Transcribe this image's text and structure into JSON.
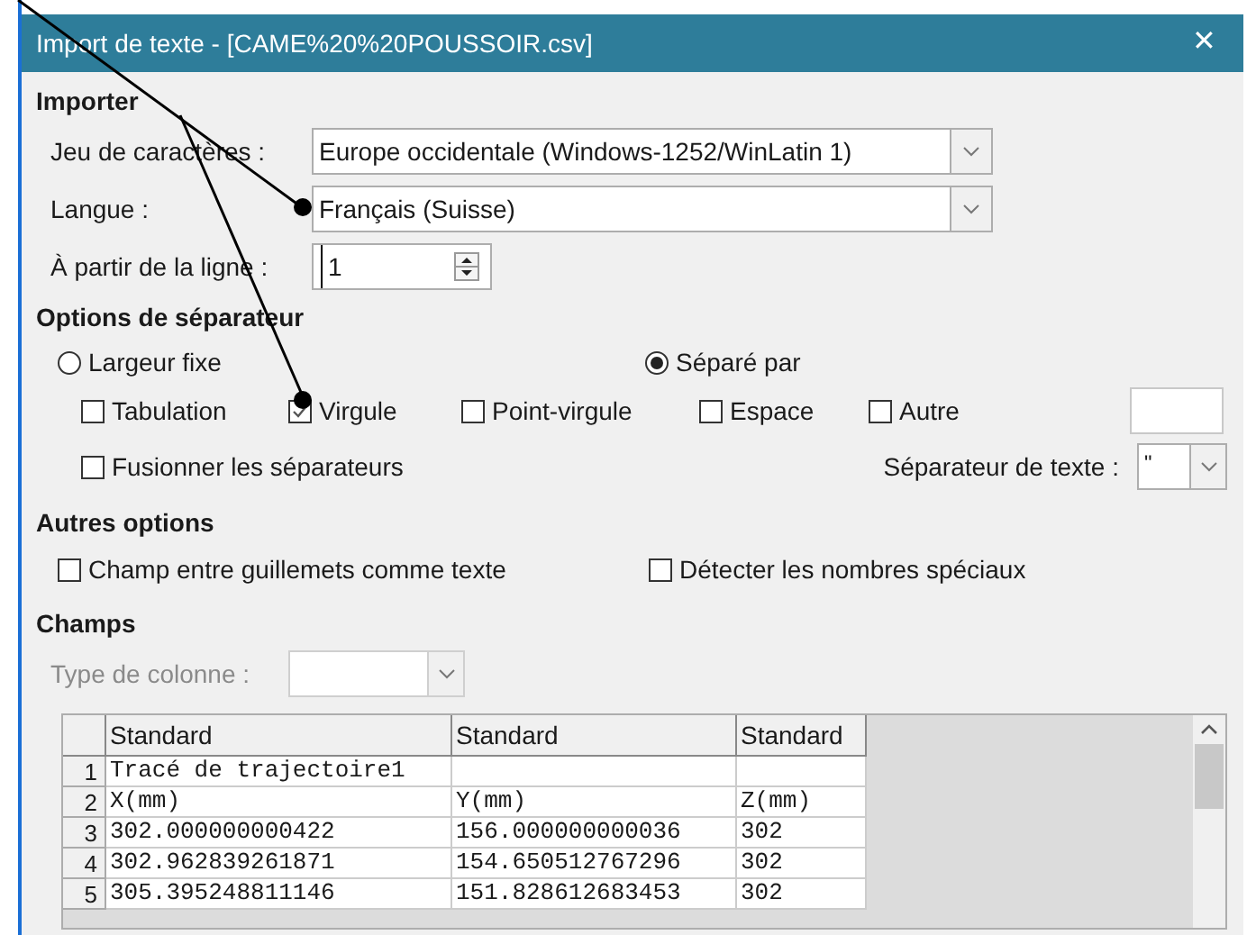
{
  "window": {
    "title": "Import de texte - [CAME%20%20POUSSOIR.csv]",
    "close": "✕"
  },
  "import": {
    "heading": "Importer",
    "fields": [
      {
        "kind": "combo",
        "label": "Jeu de caractères :",
        "value": "Europe occidentale (Windows-1252/WinLatin 1)"
      },
      {
        "kind": "combo",
        "label": "Langue :",
        "value": "Français (Suisse)"
      },
      {
        "kind": "spin",
        "label": "À partir de la ligne :",
        "value": "1"
      }
    ]
  },
  "separator_options": {
    "heading": "Options de séparateur",
    "radios": [
      {
        "label": "Largeur fixe",
        "selected": false
      },
      {
        "label": "Séparé par",
        "selected": true
      }
    ],
    "separators": [
      {
        "label": "Tabulation",
        "checked": false
      },
      {
        "label": "Virgule",
        "checked": true
      },
      {
        "label": "Point-virgule",
        "checked": false
      },
      {
        "label": "Espace",
        "checked": false
      },
      {
        "label": "Autre",
        "checked": false
      }
    ],
    "merge": {
      "label": "Fusionner les séparateurs",
      "checked": false
    },
    "text_separator": {
      "label": "Séparateur de texte :",
      "value": "\""
    }
  },
  "other_options": {
    "heading": "Autres options",
    "checkboxes": [
      {
        "label": "Champ entre guillemets comme texte",
        "checked": false
      },
      {
        "label": "Détecter les nombres spéciaux",
        "checked": false
      }
    ]
  },
  "fields": {
    "heading": "Champs",
    "column_type": {
      "label": "Type de colonne :",
      "disabled": true
    },
    "table": {
      "columns": [
        "Standard",
        "Standard",
        "Standard"
      ],
      "rows": [
        {
          "number": "1",
          "cells": [
            "Tracé de trajectoire1",
            "",
            ""
          ]
        },
        {
          "number": "2",
          "cells": [
            "X(mm)",
            "Y(mm)",
            "Z(mm)"
          ]
        },
        {
          "number": "3",
          "cells": [
            "302.000000000422",
            "156.000000000036",
            "302"
          ]
        },
        {
          "number": "4",
          "cells": [
            "302.962839261871",
            "154.650512767296",
            "302"
          ]
        },
        {
          "number": "5",
          "cells": [
            "305.395248811146",
            "151.828612683453",
            "302"
          ]
        }
      ]
    }
  }
}
